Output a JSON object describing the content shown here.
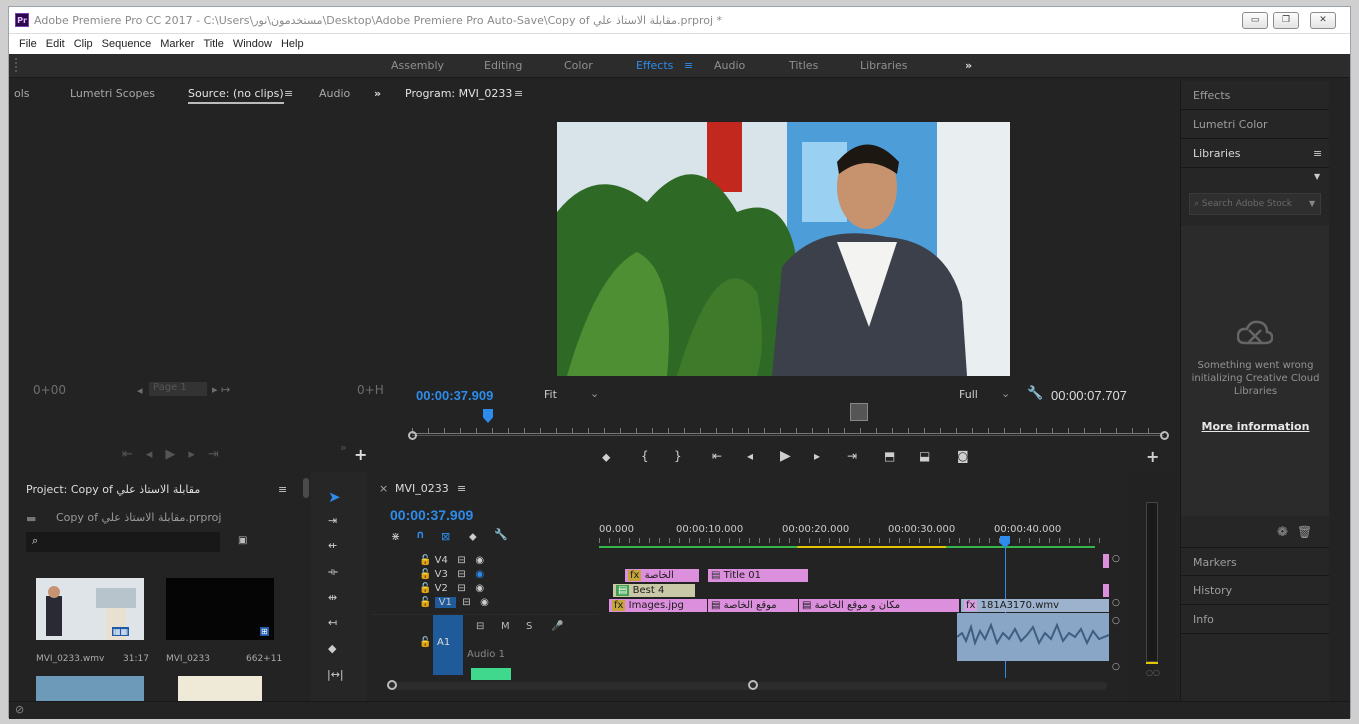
{
  "window": {
    "title": "Adobe Premiere Pro CC 2017 - C:\\Users\\مستخدمون\\نور\\Desktop\\Adobe Premiere Pro Auto-Save\\Copy of مقابلة الاستاذ علي.prproj *",
    "app_icon": "Pr",
    "buttons": [
      "minimize",
      "maximize",
      "close"
    ]
  },
  "menu": [
    "File",
    "Edit",
    "Clip",
    "Sequence",
    "Marker",
    "Title",
    "Window",
    "Help"
  ],
  "workspaces": {
    "items": [
      "Assembly",
      "Editing",
      "Color",
      "Effects",
      "Audio",
      "Titles",
      "Libraries"
    ],
    "active": "Effects",
    "overflow": "»"
  },
  "source_panel": {
    "tabs": [
      "ols",
      "Lumetri Scopes",
      "Source: (no clips)",
      "Audio"
    ],
    "active_tab": "Source: (no clips)",
    "timecode_left": "0+00",
    "timecode_right": "0+H",
    "page_label": "Page 1"
  },
  "program_panel": {
    "title": "Program: MVI_0233",
    "timecode": "00:00:37.909",
    "duration": "00:00:07.707",
    "zoom": "Fit",
    "resolution": "Full",
    "frame_image": "video frame: man in dark suit jacket and white turtleneck seated beside green plant"
  },
  "project_panel": {
    "title": "Project: Copy of مقابلة الاستاذ علي",
    "file": "Copy of مقابلة الاستاذ علي.prproj",
    "items": [
      {
        "name": "MVI_0233.wmv",
        "duration": "31:17"
      },
      {
        "name": "MVI_0233",
        "duration": "662+11"
      }
    ]
  },
  "timeline": {
    "tab": "MVI_0233",
    "timecode": "00:00:37.909",
    "ruler": [
      "00.000",
      "00:00:10.000",
      "00:00:20.000",
      "00:00:30.000",
      "00:00:40.000"
    ],
    "tracks": [
      {
        "name": "V4"
      },
      {
        "name": "V3"
      },
      {
        "name": "V2"
      },
      {
        "name": "V1"
      }
    ],
    "audio": {
      "name": "A1",
      "label": "Audio 1",
      "m": "M",
      "s": "S"
    },
    "clips": [
      {
        "track": "V3",
        "label": "الخاصة",
        "fx": "fx"
      },
      {
        "track": "V3",
        "label": "Title 01"
      },
      {
        "track": "V2",
        "label": "Best 4"
      },
      {
        "track": "V1",
        "label": "Images.jpg",
        "fx": "fx"
      },
      {
        "track": "V1",
        "label": "موقع الخاصة"
      },
      {
        "track": "V1",
        "label": "مكان و موقع الخاصة"
      },
      {
        "track": "V1",
        "label": "181A3170.wmv",
        "fx": "fx"
      }
    ],
    "playhead_fraction": 0.81,
    "progress_fraction": 0.52
  },
  "right_panel": {
    "items": [
      "Effects",
      "Lumetri Color",
      "Libraries"
    ],
    "search_placeholder": "Search Adobe Stock",
    "error": "Something went wrong initializing Creative Cloud Libraries",
    "link": "More information",
    "bottom_items": [
      "Markers",
      "History",
      "Info"
    ]
  },
  "colors": {
    "accent_blue": "#2d8ceb",
    "clip_pink": "#dc8fdc",
    "clip_audio": "#9cb2cd",
    "clip_green": "#8bd29b"
  }
}
